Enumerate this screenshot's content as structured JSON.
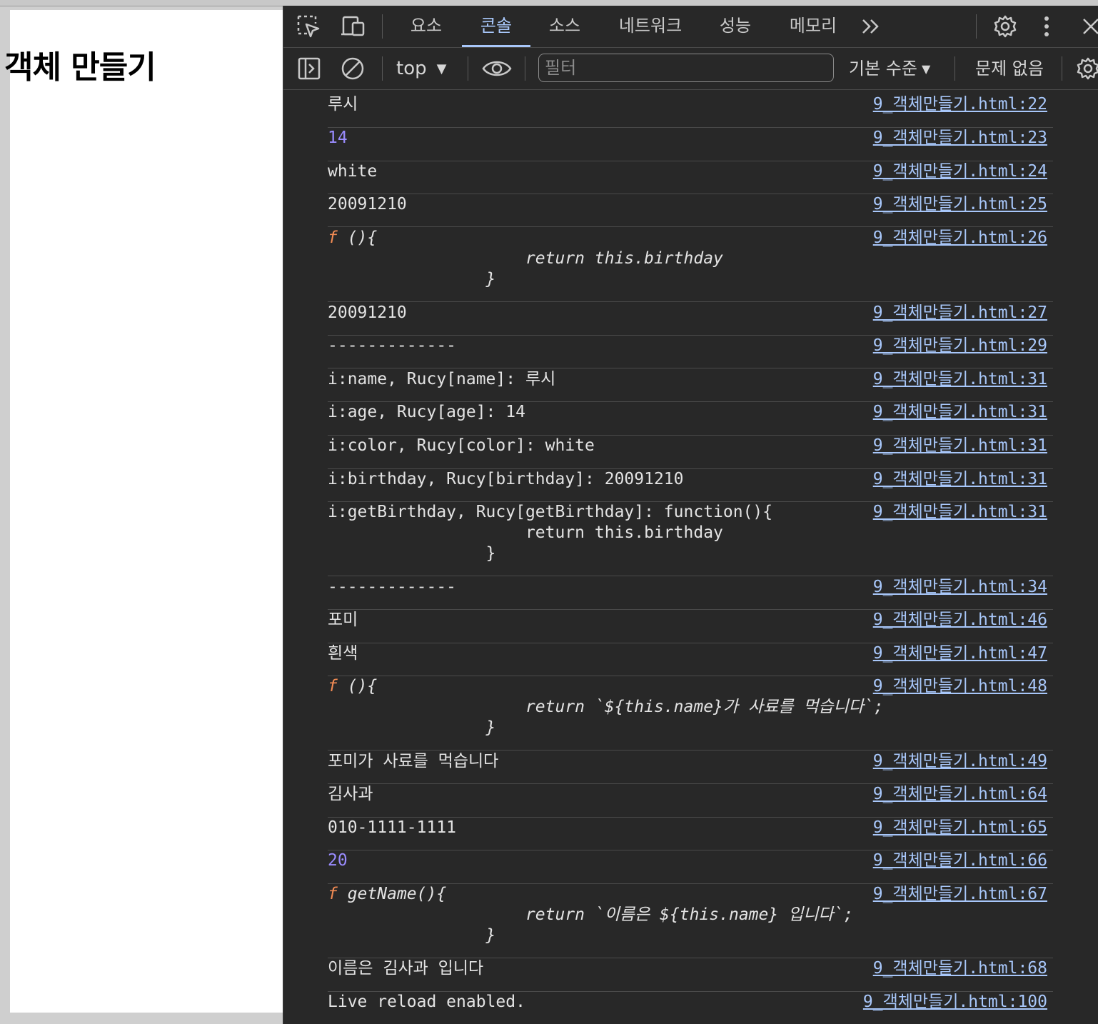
{
  "page": {
    "heading": "객체 만들기"
  },
  "tabs": [
    {
      "label": "요소"
    },
    {
      "label": "콘솔"
    },
    {
      "label": "소스"
    },
    {
      "label": "네트워크"
    },
    {
      "label": "성능"
    },
    {
      "label": "메모리"
    }
  ],
  "toolbar": {
    "context": "top",
    "filter_placeholder": "필터",
    "levels": "기본 수준",
    "issues": "문제 없음"
  },
  "console": {
    "messages": [
      {
        "text": "루시",
        "source": "9_객체만들기.html:22"
      },
      {
        "text": "14",
        "source": "9_객체만들기.html:23"
      },
      {
        "text": "white",
        "source": "9_객체만들기.html:24"
      },
      {
        "text": "20091210",
        "source": "9_객체만들기.html:25"
      },
      {
        "fn_prefix": "f",
        "text": " (){\n                    return this.birthday\n                }",
        "source": "9_객체만들기.html:26"
      },
      {
        "text": "20091210",
        "source": "9_객체만들기.html:27"
      },
      {
        "text": "-------------",
        "source": "9_객체만들기.html:29"
      },
      {
        "text": "i:name, Rucy[name]: 루시",
        "source": "9_객체만들기.html:31"
      },
      {
        "text": "i:age, Rucy[age]: 14",
        "source": "9_객체만들기.html:31"
      },
      {
        "text": "i:color, Rucy[color]: white",
        "source": "9_객체만들기.html:31"
      },
      {
        "text": "i:birthday, Rucy[birthday]: 20091210",
        "source": "9_객체만들기.html:31"
      },
      {
        "text": "i:getBirthday, Rucy[getBirthday]: function(){\n                    return this.birthday\n                }",
        "source": "9_객체만들기.html:31"
      },
      {
        "text": "-------------",
        "source": "9_객체만들기.html:34"
      },
      {
        "text": "포미",
        "source": "9_객체만들기.html:46"
      },
      {
        "text": "흰색",
        "source": "9_객체만들기.html:47"
      },
      {
        "fn_prefix": "f",
        "text": " (){\n                    return `${this.name}가 사료를 먹습니다`;\n                }",
        "source": "9_객체만들기.html:48"
      },
      {
        "text": "포미가 사료를 먹습니다",
        "source": "9_객체만들기.html:49"
      },
      {
        "text": "김사과",
        "source": "9_객체만들기.html:64"
      },
      {
        "text": "010-1111-1111",
        "source": "9_객체만들기.html:65"
      },
      {
        "text": "20",
        "source": "9_객체만들기.html:66"
      },
      {
        "fn_prefix": "f",
        "text": " getName(){\n                    return `이름은 ${this.name} 입니다`;\n                }",
        "source": "9_객체만들기.html:67"
      },
      {
        "text": "이름은 김사과 입니다",
        "source": "9_객체만들기.html:68"
      },
      {
        "text": "Live reload enabled.",
        "source": "9_객체만들기.html:100"
      }
    ]
  }
}
